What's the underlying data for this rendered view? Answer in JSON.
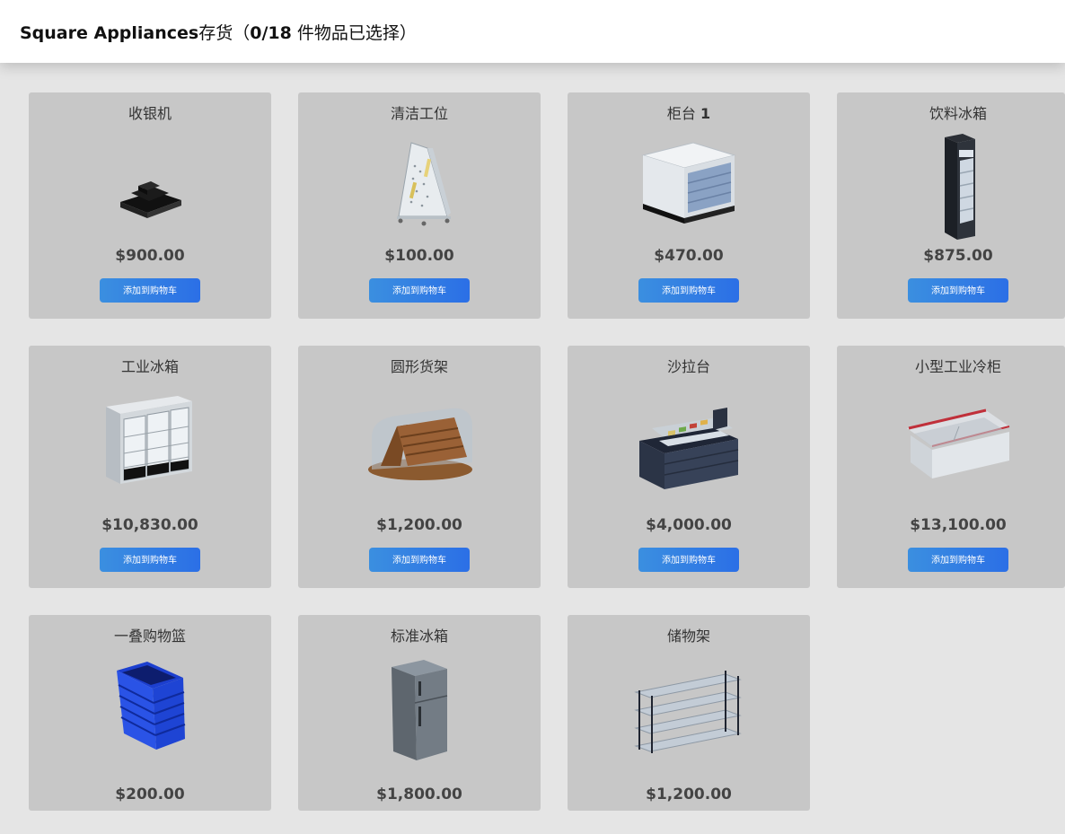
{
  "header": {
    "store_name": "Square Appliances",
    "store_suffix": "存货（",
    "selection_count": "0/18",
    "selection_suffix": " 件物品已选择）"
  },
  "colors": {
    "card_bg": "#c7c7c7",
    "page_bg": "#e5e5e5",
    "button_gradient_start": "#3b8fe0",
    "button_gradient_end": "#2b6fe6"
  },
  "items": [
    {
      "name": "收银机",
      "name_suffix": "",
      "price": "$900.00",
      "button": "添加到购物车",
      "icon": "cash-register-icon"
    },
    {
      "name": "清洁工位",
      "name_suffix": "",
      "price": "$100.00",
      "button": "添加到购物车",
      "icon": "cleaning-station-icon"
    },
    {
      "name": "柜台 ",
      "name_suffix": "1",
      "price": "$470.00",
      "button": "添加到购物车",
      "icon": "counter-icon"
    },
    {
      "name": "饮料冰箱",
      "name_suffix": "",
      "price": "$875.00",
      "button": "添加到购物车",
      "icon": "drink-fridge-icon"
    },
    {
      "name": "工业冰箱",
      "name_suffix": "",
      "price": "$10,830.00",
      "button": "添加到购物车",
      "icon": "industrial-fridge-icon"
    },
    {
      "name": "圆形货架",
      "name_suffix": "",
      "price": "$1,200.00",
      "button": "添加到购物车",
      "icon": "round-shelf-icon"
    },
    {
      "name": "沙拉台",
      "name_suffix": "",
      "price": "$4,000.00",
      "button": "添加到购物车",
      "icon": "salad-bar-icon"
    },
    {
      "name": "小型工业冷柜",
      "name_suffix": "",
      "price": "$13,100.00",
      "button": "添加到购物车",
      "icon": "small-freezer-icon"
    },
    {
      "name": "一叠购物篮",
      "name_suffix": "",
      "price": "$200.00",
      "button": "",
      "icon": "basket-stack-icon"
    },
    {
      "name": "标准冰箱",
      "name_suffix": "",
      "price": "$1,800.00",
      "button": "",
      "icon": "standard-fridge-icon"
    },
    {
      "name": "储物架",
      "name_suffix": "",
      "price": "$1,200.00",
      "button": "",
      "icon": "storage-rack-icon"
    }
  ]
}
